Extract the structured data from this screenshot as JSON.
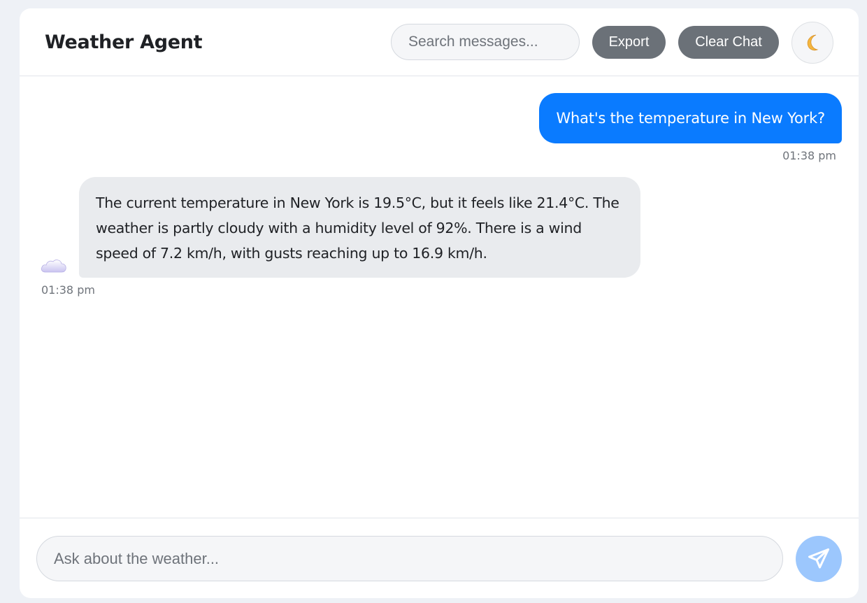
{
  "header": {
    "title": "Weather Agent",
    "search_placeholder": "Search messages...",
    "export_label": "Export",
    "clear_label": "Clear Chat",
    "theme_icon": "moon-icon"
  },
  "messages": [
    {
      "role": "user",
      "text": "What's the temperature in New York?",
      "time": "01:38 pm"
    },
    {
      "role": "assistant",
      "avatar_icon": "cloud-icon",
      "text": "The current temperature in New York is 19.5°C, but it feels like 21.4°C. The weather is partly cloudy with a humidity level of 92%. There is a wind speed of 7.2 km/h, with gusts reaching up to 16.9 km/h.",
      "time": "01:38 pm"
    }
  ],
  "composer": {
    "placeholder": "Ask about the weather...",
    "send_icon": "send-icon"
  },
  "colors": {
    "accent": "#0a7bff",
    "send_button": "#9cc7fd",
    "secondary_button": "#6b7178",
    "bot_bubble": "#e9ebee",
    "page_background": "#eef1f6"
  }
}
